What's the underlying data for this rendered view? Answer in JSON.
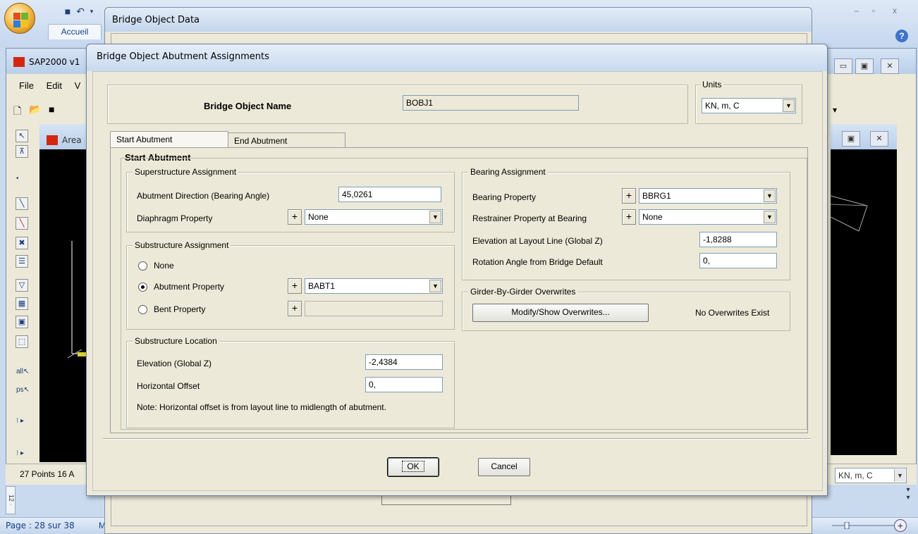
{
  "word": {
    "ribbon_tab": "Accueil",
    "page_status": "Page : 28 sur 38",
    "status_m": "M",
    "help_icon": "?",
    "ctrl_min": "–",
    "ctrl_max": "▫",
    "ctrl_close": "x",
    "ruler_text": "12 ·"
  },
  "sap": {
    "title": "SAP2000 v1",
    "menu": [
      "File",
      "Edit",
      "V"
    ],
    "area_window_title": "Area",
    "status_points": "27 Points  16 A",
    "units_value": "KN, m, C"
  },
  "bridge_object_data": {
    "title": "Bridge Object Data"
  },
  "dialog": {
    "title": "Bridge Object Abutment Assignments",
    "name_label": "Bridge Object Name",
    "name_value": "BOBJ1",
    "units_label": "Units",
    "units_value": "KN, m, C",
    "tabs": [
      "Start Abutment",
      "End Abutment"
    ],
    "panel_heading": "Start Abutment",
    "superstructure": {
      "label": "Superstructure Assignment",
      "direction_label": "Abutment Direction (Bearing Angle)",
      "direction_value": "45,0261",
      "diaphragm_label": "Diaphragm Property",
      "diaphragm_value": "None"
    },
    "substructure": {
      "label": "Substructure Assignment",
      "options": [
        "None",
        "Abutment Property",
        "Bent Property"
      ],
      "selected": "Abutment Property",
      "abutment_value": "BABT1",
      "bent_value": ""
    },
    "location": {
      "label": "Substructure Location",
      "elevation_label": "Elevation (Global Z)",
      "elevation_value": "-2,4384",
      "offset_label": "Horizontal Offset",
      "offset_value": "0,",
      "note": "Note:  Horizontal offset is from layout line to midlength of abutment."
    },
    "bearing": {
      "label": "Bearing Assignment",
      "property_label": "Bearing Property",
      "property_value": "BBRG1",
      "restrainer_label": "Restrainer Property at Bearing",
      "restrainer_value": "None",
      "elevation_label": "Elevation at Layout Line (Global Z)",
      "elevation_value": "-1,8288",
      "rotation_label": "Rotation Angle from Bridge Default",
      "rotation_value": "0,"
    },
    "overwrites": {
      "label": "Girder-By-Girder Overwrites",
      "button": "Modify/Show Overwrites...",
      "status": "No Overwrites Exist"
    },
    "ok_label": "OK",
    "cancel_label": "Cancel",
    "plus_symbol": "+",
    "dropdown_symbol": "▼"
  },
  "icons": {
    "dropdown": "chevron-down-icon",
    "plus": "plus-icon"
  },
  "colors": {
    "dialog_bg": "#ece9d8",
    "title_gradient_top": "#e6eef9",
    "title_gradient_bottom": "#c8d9ef",
    "input_border": "#7f9db9"
  }
}
